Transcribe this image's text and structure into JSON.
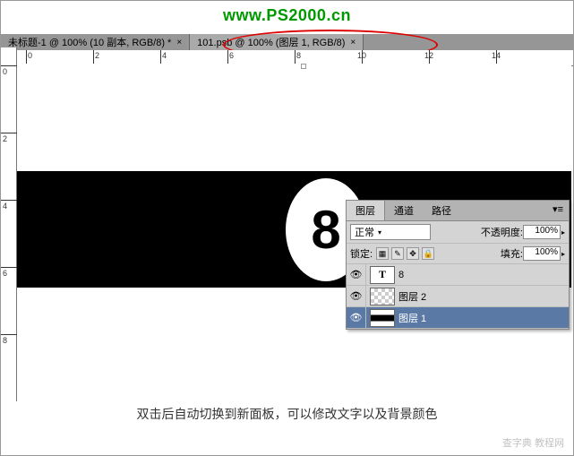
{
  "watermark": "www.PS2000.cn",
  "tabs": [
    {
      "label": "未标题-1 @ 100% (10 副本, RGB/8) *"
    },
    {
      "label": "101.psb @ 100% (图层 1, RGB/8)"
    }
  ],
  "ruler_h": [
    "0",
    "2",
    "4",
    "6",
    "8",
    "10",
    "12",
    "14"
  ],
  "ruler_v": [
    "0",
    "2",
    "4",
    "6",
    "8"
  ],
  "canvas": {
    "ball_number": "8"
  },
  "panel": {
    "tabs": {
      "layers": "图层",
      "channels": "通道",
      "paths": "路径"
    },
    "blend_mode": "正常",
    "opacity_label": "不透明度:",
    "opacity_value": "100%",
    "lock_label": "锁定:",
    "fill_label": "填充:",
    "fill_value": "100%",
    "layers": [
      {
        "name": "8",
        "type": "text"
      },
      {
        "name": "图层 2",
        "type": "shape"
      },
      {
        "name": "图层 1",
        "type": "image"
      }
    ]
  },
  "caption": "双击后自动切换到新面板，可以修改文字以及背景颜色",
  "bottom_watermark": "查字典 教程网"
}
